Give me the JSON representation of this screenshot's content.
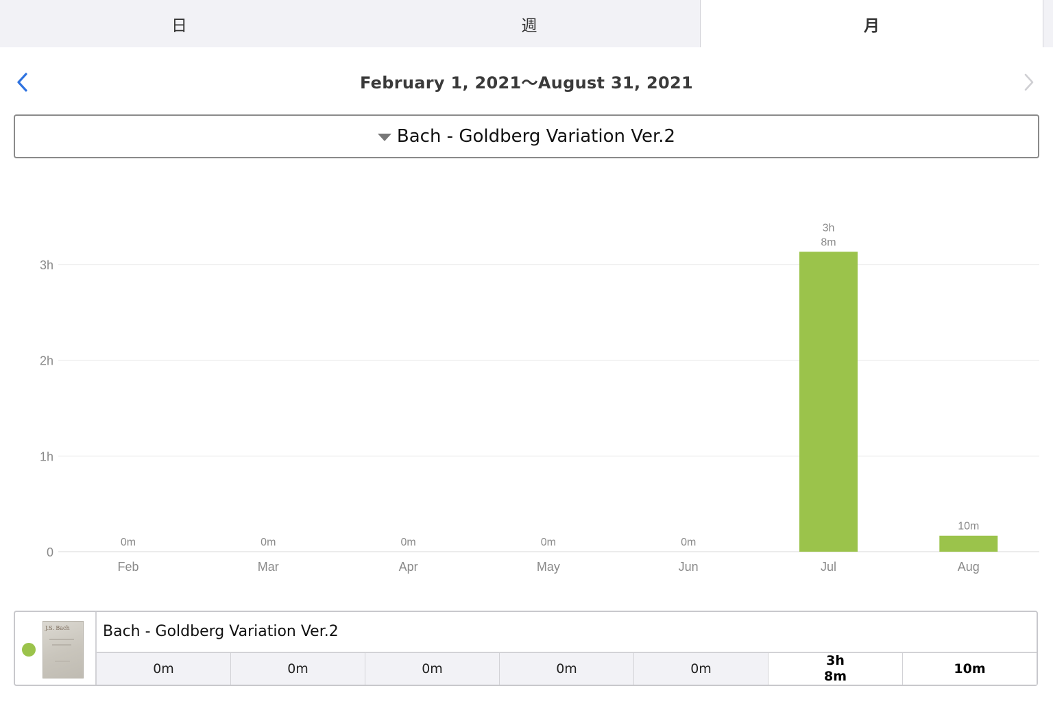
{
  "tabs": [
    {
      "label": "日"
    },
    {
      "label": "週"
    },
    {
      "label": "月"
    }
  ],
  "header": {
    "date_range": "February 1, 2021〜August 31, 2021"
  },
  "selector": {
    "label": "Bach - Goldberg Variation Ver.2"
  },
  "chart_data": {
    "type": "bar",
    "categories": [
      "Feb",
      "Mar",
      "Apr",
      "May",
      "Jun",
      "Jul",
      "Aug"
    ],
    "values": [
      0,
      0,
      0,
      0,
      0,
      188,
      10
    ],
    "value_unit": "minutes",
    "data_labels": [
      [
        "0m"
      ],
      [
        "0m"
      ],
      [
        "0m"
      ],
      [
        "0m"
      ],
      [
        "0m"
      ],
      [
        "3h",
        "8m"
      ],
      [
        "10m"
      ]
    ],
    "yticks": [
      {
        "value": 0,
        "label": "0"
      },
      {
        "value": 60,
        "label": "1h"
      },
      {
        "value": 120,
        "label": "2h"
      },
      {
        "value": 180,
        "label": "3h"
      }
    ],
    "ylim": [
      0,
      180
    ],
    "grid": true,
    "color": "#9bc34b"
  },
  "summary": {
    "title": "Bach - Goldberg Variation Ver.2",
    "thumbnail_text": "J.S. Bach",
    "dot_color": "#9bc34b",
    "cells": [
      {
        "lines": [
          "0m"
        ],
        "highlight": false
      },
      {
        "lines": [
          "0m"
        ],
        "highlight": false
      },
      {
        "lines": [
          "0m"
        ],
        "highlight": false
      },
      {
        "lines": [
          "0m"
        ],
        "highlight": false
      },
      {
        "lines": [
          "0m"
        ],
        "highlight": false
      },
      {
        "lines": [
          "3h",
          "8m"
        ],
        "highlight": true
      },
      {
        "lines": [
          "10m"
        ],
        "highlight": true
      }
    ]
  }
}
